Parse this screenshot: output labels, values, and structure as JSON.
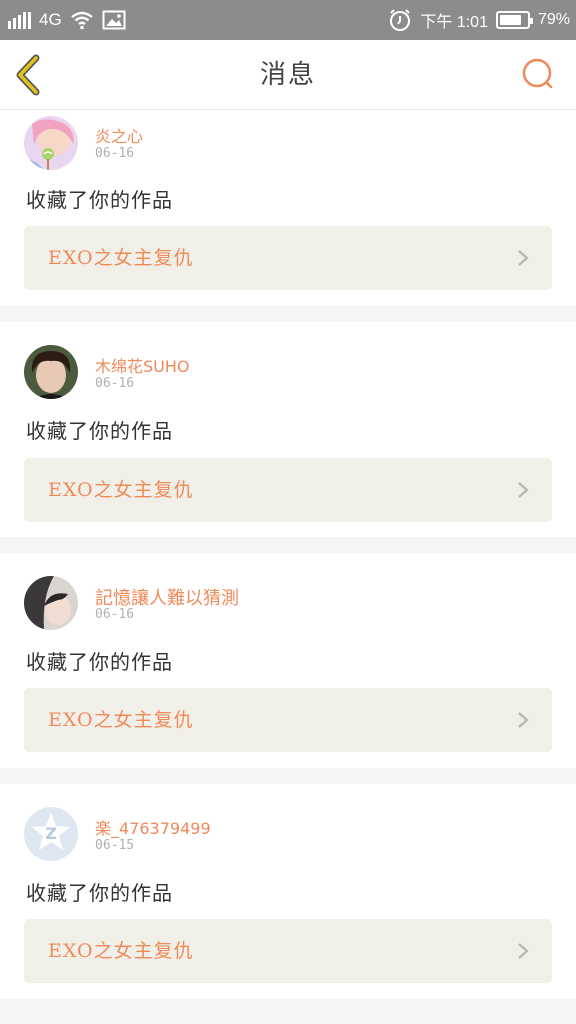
{
  "status_bar": {
    "network": "4G",
    "time": "下午 1:01",
    "battery": "79%",
    "battery_level": 0.79
  },
  "header": {
    "title": "消息"
  },
  "messages": [
    {
      "user": "炎之心",
      "date": "06-16",
      "action": "收藏了你的作品",
      "work": "EXO之女主复仇"
    },
    {
      "user": "木绵花SUHO",
      "date": "06-16",
      "action": "收藏了你的作品",
      "work": "EXO之女主复仇"
    },
    {
      "user": "記憶讓人難以猜測",
      "date": "06-16",
      "action": "收藏了你的作品",
      "work": "EXO之女主复仇"
    },
    {
      "user": "楽_476379499",
      "date": "06-15",
      "action": "收藏了你的作品",
      "work": "EXO之女主复仇"
    }
  ],
  "colors": {
    "accent": "#ef8a5a",
    "back_arrow": "#e2c21c",
    "work_box": "#f1f0e8"
  },
  "icons": {
    "back": "chevron-left-icon",
    "search": "search-icon",
    "row_arrow": "chevron-right-icon"
  }
}
